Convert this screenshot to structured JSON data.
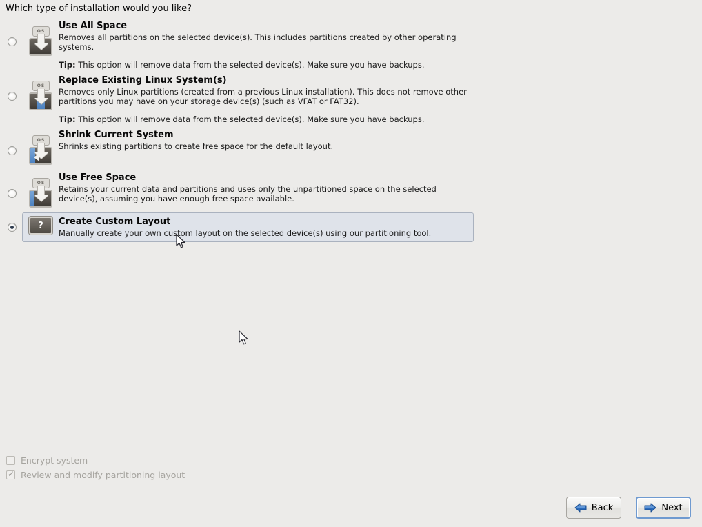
{
  "page": {
    "question": "Which type of installation would you like?"
  },
  "options": [
    {
      "id": "use-all-space",
      "title": "Use All Space",
      "description": "Removes all partitions on the selected device(s).  This includes partitions created by other operating systems.",
      "tip_label": "Tip:",
      "tip": "This option will remove data from the selected device(s).  Make sure you have backups.",
      "selected": false,
      "icon": "disk-os-wipe-icon"
    },
    {
      "id": "replace-existing-linux",
      "title": "Replace Existing Linux System(s)",
      "description": "Removes only Linux partitions (created from a previous Linux installation).  This does not remove other partitions you may have on your storage device(s) (such as VFAT or FAT32).",
      "tip_label": "Tip:",
      "tip": "This option will remove data from the selected device(s).  Make sure you have backups.",
      "selected": false,
      "icon": "disk-os-replace-icon"
    },
    {
      "id": "shrink-current-system",
      "title": "Shrink Current System",
      "description": "Shrinks existing partitions to create free space for the default layout.",
      "tip_label": "",
      "tip": "",
      "selected": false,
      "icon": "disk-os-shrink-icon"
    },
    {
      "id": "use-free-space",
      "title": "Use Free Space",
      "description": "Retains your current data and partitions and uses only the unpartitioned space on the selected device(s), assuming you have enough free space available.",
      "tip_label": "",
      "tip": "",
      "selected": false,
      "icon": "disk-os-freespace-icon"
    },
    {
      "id": "create-custom-layout",
      "title": "Create Custom Layout",
      "description": "Manually create your own custom layout on the selected device(s) using our partitioning tool.",
      "tip_label": "",
      "tip": "",
      "selected": true,
      "icon": "question-mark-icon"
    }
  ],
  "icon_label": "OS",
  "question_glyph": "?",
  "checkboxes": [
    {
      "id": "encrypt-system",
      "label": "Encrypt system",
      "checked": false,
      "disabled": true
    },
    {
      "id": "review-modify-partitioning",
      "label": "Review and modify partitioning layout",
      "checked": true,
      "disabled": true
    }
  ],
  "buttons": {
    "back": "Back",
    "next": "Next"
  },
  "colors": {
    "background": "#ecebe9",
    "selected_row_bg": "#dfe3ea",
    "selected_row_border": "#aab2bf",
    "accent_blue": "#2a6bbd",
    "focus_border": "#6f9ad0",
    "disabled_text": "#a6a49f"
  }
}
